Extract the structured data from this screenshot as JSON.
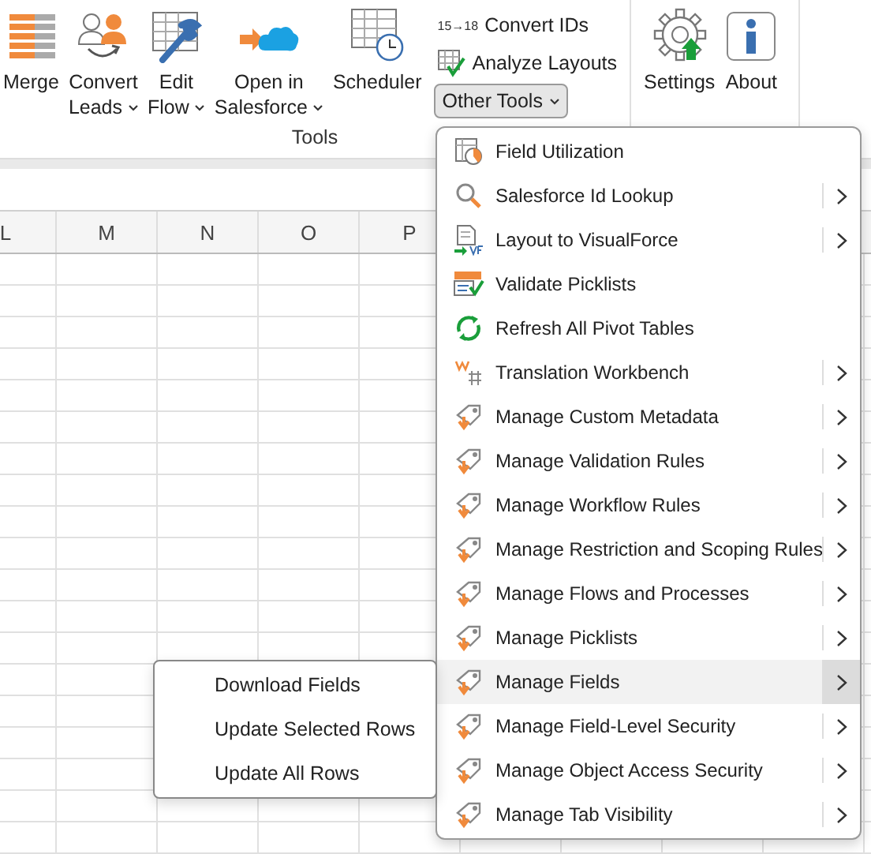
{
  "ribbon": {
    "groups": [
      {
        "label": "Tools",
        "buttons": [
          {
            "kind": "merge",
            "lines": [
              "Merge"
            ],
            "dropdown": false
          },
          {
            "kind": "convert",
            "lines": [
              "Convert",
              "Leads"
            ],
            "dropdown": true
          },
          {
            "kind": "flow",
            "lines": [
              "Edit",
              "Flow"
            ],
            "dropdown": true
          },
          {
            "kind": "cloud",
            "lines": [
              "Open in",
              "Salesforce"
            ],
            "dropdown": true
          },
          {
            "kind": "scheduler",
            "lines": [
              "Scheduler"
            ],
            "dropdown": false
          }
        ],
        "small_buttons": [
          {
            "kind": "ids",
            "icon_text": "15→18",
            "label": "Convert IDs"
          },
          {
            "kind": "analyze",
            "label": "Analyze Layouts"
          }
        ],
        "dropdown_button": {
          "label": "Other Tools",
          "pressed": true
        }
      },
      {
        "buttons": [
          {
            "kind": "settings",
            "lines": [
              "Settings"
            ],
            "dropdown": false
          },
          {
            "kind": "about",
            "lines": [
              "About"
            ],
            "dropdown": false
          }
        ]
      }
    ]
  },
  "sheet": {
    "columns": [
      "L",
      "M",
      "N",
      "O",
      "P"
    ]
  },
  "menu": {
    "items": [
      {
        "kind": "utilization",
        "label": "Field Utilization",
        "submenu": false,
        "selected": false
      },
      {
        "kind": "lookup",
        "label": "Salesforce Id Lookup",
        "submenu": true,
        "selected": false
      },
      {
        "kind": "layout",
        "label": "Layout to VisualForce",
        "submenu": true,
        "selected": false
      },
      {
        "kind": "validate",
        "label": "Validate Picklists",
        "submenu": false,
        "selected": false
      },
      {
        "kind": "refresh",
        "label": "Refresh All Pivot Tables",
        "submenu": false,
        "selected": false
      },
      {
        "kind": "translate",
        "label": "Translation Workbench",
        "submenu": true,
        "selected": false
      },
      {
        "kind": "tag",
        "label": "Manage Custom Metadata",
        "submenu": true,
        "selected": false
      },
      {
        "kind": "tag",
        "label": "Manage Validation Rules",
        "submenu": true,
        "selected": false
      },
      {
        "kind": "tag",
        "label": "Manage Workflow Rules",
        "submenu": true,
        "selected": false
      },
      {
        "kind": "tag",
        "label": "Manage Restriction and Scoping Rules",
        "submenu": true,
        "selected": false
      },
      {
        "kind": "tag",
        "label": "Manage Flows and Processes",
        "submenu": true,
        "selected": false
      },
      {
        "kind": "tag",
        "label": "Manage Picklists",
        "submenu": true,
        "selected": false
      },
      {
        "kind": "tag",
        "label": "Manage Fields",
        "submenu": true,
        "selected": true
      },
      {
        "kind": "tag",
        "label": "Manage Field-Level Security",
        "submenu": true,
        "selected": false
      },
      {
        "kind": "tag",
        "label": "Manage Object Access Security",
        "submenu": true,
        "selected": false
      },
      {
        "kind": "tag",
        "label": "Manage Tab Visibility",
        "submenu": true,
        "selected": false
      }
    ]
  },
  "submenu": {
    "items": [
      "Download Fields",
      "Update Selected Rows",
      "Update All Rows"
    ]
  }
}
